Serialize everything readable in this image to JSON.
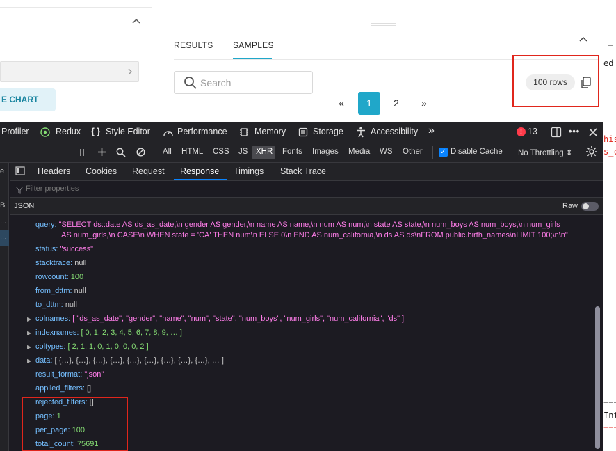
{
  "app": {
    "left": {
      "chart_button": "E CHART"
    },
    "tabs": {
      "results": "RESULTS",
      "samples": "SAMPLES"
    },
    "search": {
      "placeholder": "Search"
    },
    "pagination": {
      "prev": "«",
      "pages": [
        "1",
        "2"
      ],
      "next": "»",
      "current": "1"
    },
    "rows_badge": "100 rows"
  },
  "terminal": {
    "line1": "_",
    "line2": "ed",
    "line3": "his",
    "line4": "s_c",
    "line5": "---",
    "line6": "===",
    "line7": "Int",
    "line8": "===",
    "colors": {
      "red": "#e0261c",
      "text": "#222222"
    }
  },
  "devtools": {
    "tabs": [
      "Profiler",
      "Redux",
      "Style Editor",
      "Performance",
      "Memory",
      "Storage",
      "Accessibility"
    ],
    "more": "»",
    "error_count": "13",
    "filters": [
      "All",
      "HTML",
      "CSS",
      "JS",
      "XHR",
      "Fonts",
      "Images",
      "Media",
      "WS",
      "Other"
    ],
    "disable_cache": "Disable Cache",
    "throttling": "No Throttling ⇕",
    "side_letters": [
      "e",
      "B",
      "...",
      "..."
    ],
    "detail_tabs": [
      "Headers",
      "Cookies",
      "Request",
      "Response",
      "Timings",
      "Stack Trace"
    ],
    "filter_placeholder": "Filter properties",
    "json_label": "JSON",
    "raw_label": "Raw",
    "accent": "#0a84ff"
  },
  "json": {
    "query_key": "query:",
    "query_line1": "\"SELECT ds::date AS ds_as_date,\\n gender AS gender,\\n name AS name,\\n num AS num,\\n state AS state,\\n num_boys AS num_boys,\\n num_girls",
    "query_line2": "AS num_girls,\\n CASE\\n WHEN state = 'CA' THEN num\\n ELSE 0\\n END AS num_california,\\n ds AS ds\\nFROM public.birth_names\\nLIMIT 100;\\n\\n\"",
    "status_key": "status:",
    "status_val": "\"success\"",
    "stacktrace_key": "stacktrace:",
    "stacktrace_val": "null",
    "rowcount_key": "rowcount:",
    "rowcount_val": "100",
    "from_key": "from_dttm:",
    "from_val": "null",
    "to_key": "to_dttm:",
    "to_val": "null",
    "colnames_key": "colnames:",
    "colnames_val": "[ \"ds_as_date\", \"gender\", \"name\", \"num\", \"state\", \"num_boys\", \"num_girls\", \"num_california\", \"ds\" ]",
    "indexnames_key": "indexnames:",
    "indexnames_val": "[ 0, 1, 2, 3, 4, 5, 6, 7, 8, 9, … ]",
    "coltypes_key": "coltypes:",
    "coltypes_val": "[ 2, 1, 1, 0, 1, 0, 0, 0, 2 ]",
    "data_key": "data:",
    "data_val": "[ {…}, {…}, {…}, {…}, {…}, {…}, {…}, {…}, {…}, … ]",
    "result_format_key": "result_format:",
    "result_format_val": "\"json\"",
    "applied_key": "applied_filters:",
    "applied_val": "[]",
    "rejected_key": "rejected_filters:",
    "rejected_val": "[]",
    "page_key": "page:",
    "page_val": "1",
    "per_page_key": "per_page:",
    "per_page_val": "100",
    "total_key": "total_count:",
    "total_val": "75691"
  }
}
